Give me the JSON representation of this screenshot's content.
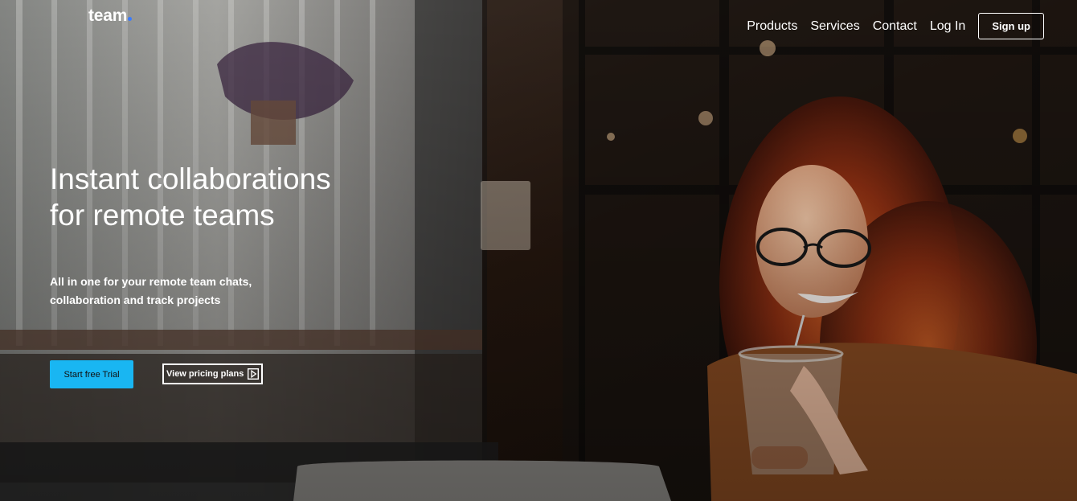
{
  "brand": {
    "name": "team"
  },
  "nav": {
    "items": [
      "Products",
      "Services",
      "Contact",
      "Log In"
    ],
    "signup_label": "Sign up"
  },
  "hero": {
    "headline": "Instant collaborations for remote teams",
    "subheadline": "All in one for your remote team chats, collaboration and track projects",
    "primary_cta": "Start free Trial",
    "secondary_cta": "View pricing plans",
    "secondary_cta_icon": "play-icon"
  },
  "colors": {
    "accent": "#19b6f2",
    "brand_dot": "#3a7bff"
  }
}
